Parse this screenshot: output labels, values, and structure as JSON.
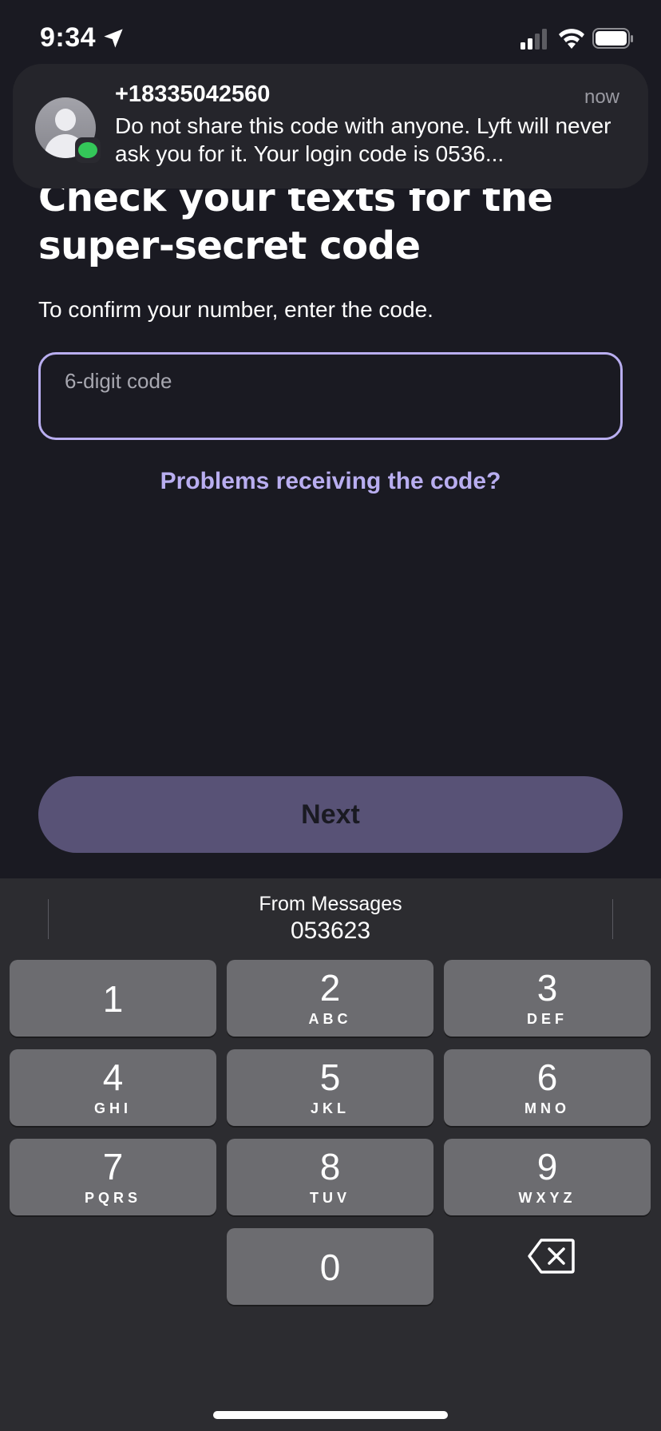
{
  "status_bar": {
    "time": "9:34",
    "icons": [
      "location-arrow-icon",
      "cellular-signal-icon",
      "wifi-icon",
      "battery-icon"
    ]
  },
  "notification": {
    "sender": "+18335042560",
    "time": "now",
    "body": "Do not share this code with anyone. Lyft will never ask you for it. Your login code is 0536...",
    "icons": [
      "contact-avatar-icon",
      "messages-app-icon"
    ]
  },
  "main": {
    "title": "Check your texts for the super-secret code",
    "subtitle": "To confirm your number, enter the code.",
    "code_input": {
      "value": "",
      "placeholder": "6-digit code"
    },
    "problems_link": "Problems receiving the code?",
    "next_button": "Next"
  },
  "keyboard": {
    "autofill": {
      "source": "From Messages",
      "code": "053623"
    },
    "keys": [
      {
        "digit": "1",
        "letters": ""
      },
      {
        "digit": "2",
        "letters": "ABC"
      },
      {
        "digit": "3",
        "letters": "DEF"
      },
      {
        "digit": "4",
        "letters": "GHI"
      },
      {
        "digit": "5",
        "letters": "JKL"
      },
      {
        "digit": "6",
        "letters": "MNO"
      },
      {
        "digit": "7",
        "letters": "PQRS"
      },
      {
        "digit": "8",
        "letters": "TUV"
      },
      {
        "digit": "9",
        "letters": "WXYZ"
      },
      {
        "digit": "0",
        "letters": ""
      }
    ],
    "delete_icon": "backspace-icon"
  },
  "colors": {
    "background": "#1a1a22",
    "accent": "#b9aef0",
    "next_button": "#585276",
    "keyboard": "#2c2c30",
    "key": "#6c6c70",
    "messages_green": "#34c759"
  }
}
